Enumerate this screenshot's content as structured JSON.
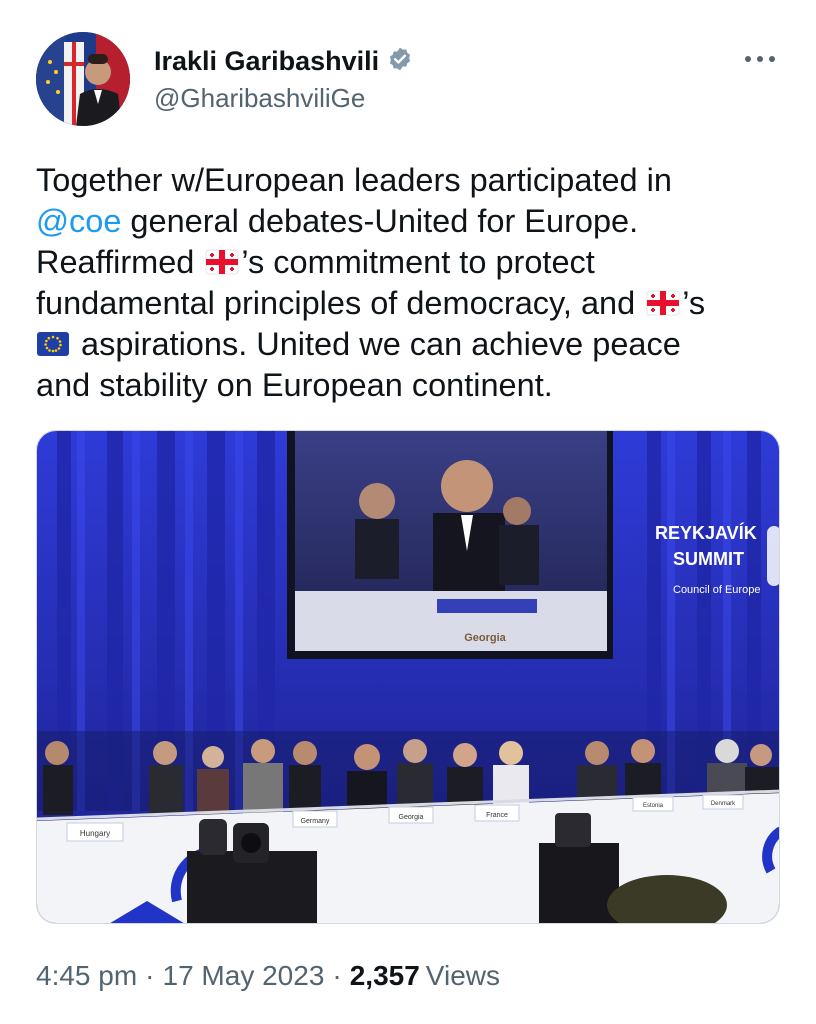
{
  "profile": {
    "display_name": "Irakli Garibashvili",
    "handle": "@GharibashviliGe",
    "verified": true,
    "avatar_icon": "profile-photo"
  },
  "tweet": {
    "line1": "Together w/European leaders participated in",
    "mention": "@coe",
    "line2_rest": " general debates-United for Europe.",
    "line3_a": "Reaffirmed ",
    "line3_b": "’s commitment to protect",
    "line4_a": "fundamental principles of democracy, and ",
    "line4_b": "’s",
    "line5_b": " aspirations. United we can achieve peace",
    "line6": "and stability on European continent.",
    "emoji": [
      "georgia-flag",
      "eu-flag"
    ]
  },
  "media": {
    "alt_icon": "summit-photo",
    "sign_title_1": "REYKJAVÍK",
    "sign_title_2": "SUMMIT",
    "sign_subtitle": "Council of Europe",
    "screen_nameplate": "Georgia",
    "nameplates": [
      "Hungary",
      "Germany",
      "Georgia",
      "France",
      "Estonia",
      "Denmark"
    ]
  },
  "meta": {
    "time": "4:45 pm",
    "date": "17 May 2023",
    "views_count": "2,357",
    "views_label": "Views",
    "separator": "·"
  },
  "colors": {
    "accent": "#1d9bf0",
    "secondary_text": "#536471",
    "verified_badge": "#829aab"
  }
}
